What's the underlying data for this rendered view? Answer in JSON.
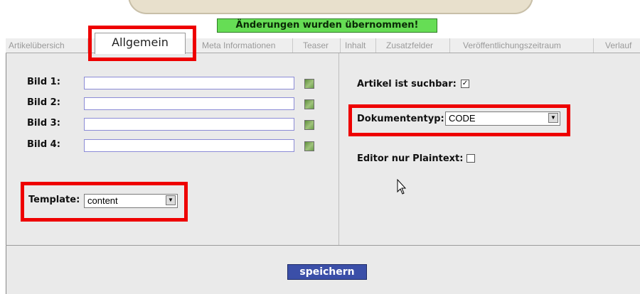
{
  "notice": "Änderungen wurden übernommen!",
  "tabs": [
    "Artikelübersich",
    "Meta Informationen",
    "Teaser",
    "Inhalt",
    "Zusatzfelder",
    "Veröffentlichungszeitraum",
    "Verlauf"
  ],
  "active_tab": "Allgemein",
  "left": {
    "images": [
      {
        "label": "Bild 1:",
        "value": ""
      },
      {
        "label": "Bild 2:",
        "value": ""
      },
      {
        "label": "Bild 3:",
        "value": ""
      },
      {
        "label": "Bild 4:",
        "value": ""
      }
    ],
    "template_label": "Template:",
    "template_value": "content"
  },
  "right": {
    "searchable_label": "Artikel ist suchbar:",
    "searchable_checked": true,
    "doctype_label": "Dokumententyp:",
    "doctype_value": "CODE",
    "plaintext_label": "Editor nur Plaintext:",
    "plaintext_checked": false
  },
  "save_label": "speichern",
  "highlight_color": "#ee0000"
}
